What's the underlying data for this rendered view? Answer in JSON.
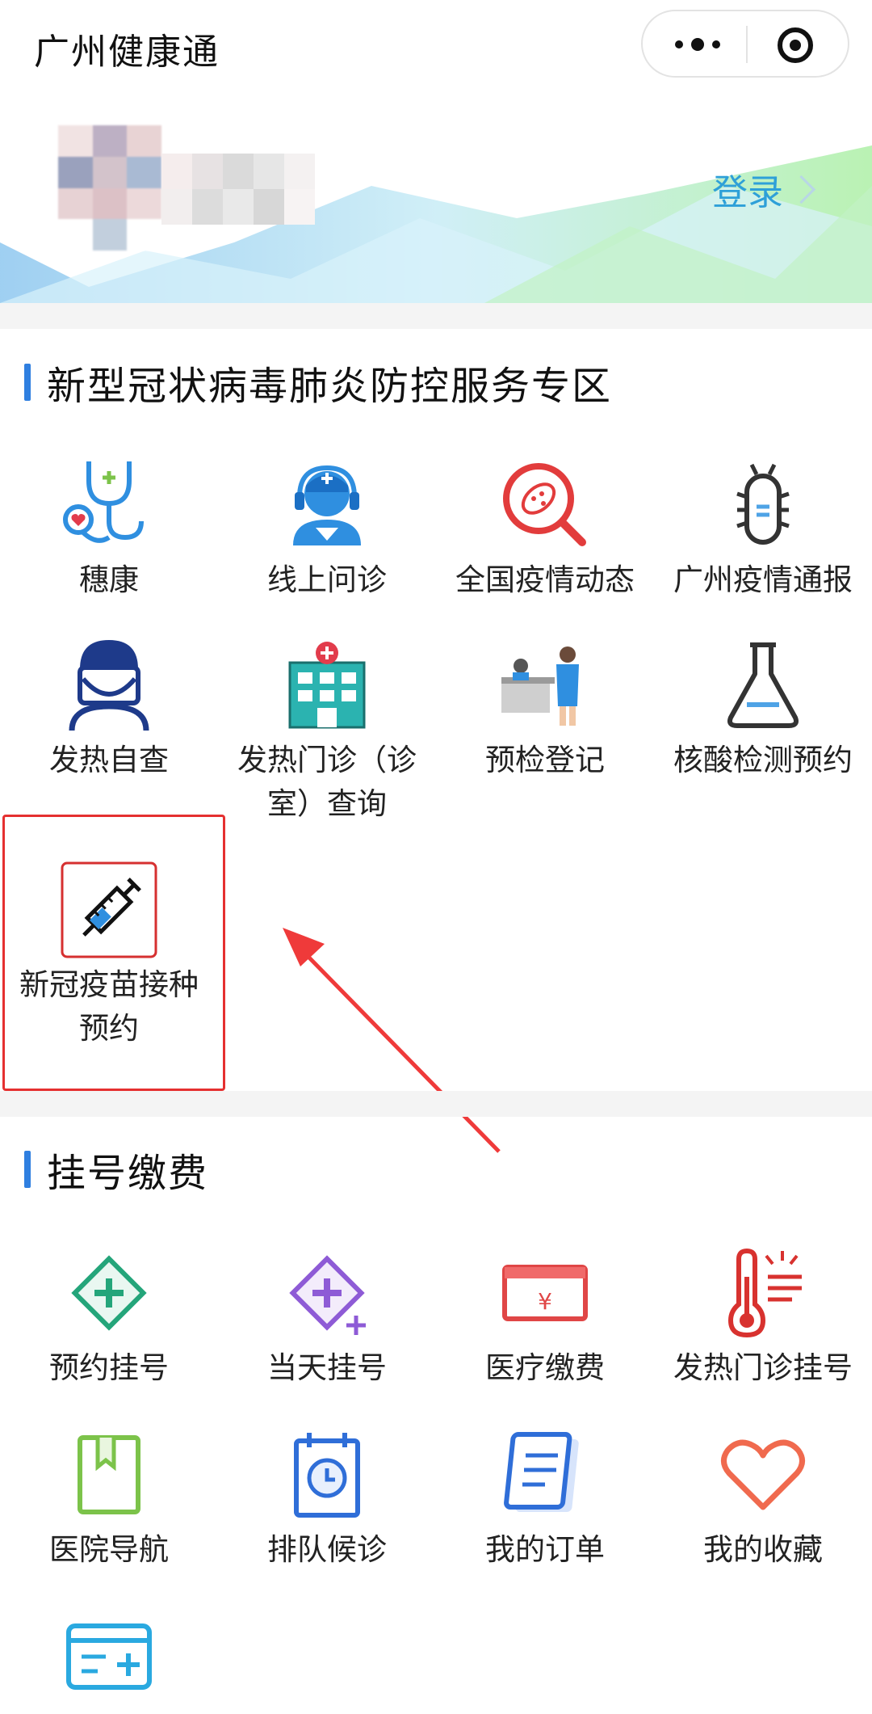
{
  "app": {
    "title": "广州健康通"
  },
  "banner": {
    "login_label": "登录"
  },
  "colors": {
    "accent": "#2f7fe0",
    "login": "#2ea0d8",
    "highlight": "#e53030"
  },
  "section_covid": {
    "title": "新型冠状病毒肺炎防控服务专区",
    "items": [
      {
        "label": "穗康",
        "icon": "stethoscope-icon"
      },
      {
        "label": "线上问诊",
        "icon": "doctor-headset-icon"
      },
      {
        "label": "全国疫情动态",
        "icon": "virus-magnifier-icon"
      },
      {
        "label": "广州疫情通报",
        "icon": "bug-icon"
      },
      {
        "label": "发热自查",
        "icon": "masked-person-icon"
      },
      {
        "label": "发热门诊（诊室）查询",
        "icon": "hospital-icon"
      },
      {
        "label": "预检登记",
        "icon": "reception-desk-icon"
      },
      {
        "label": "核酸检测预约",
        "icon": "flask-icon"
      },
      {
        "label": "新冠疫苗接种预约",
        "icon": "syringe-icon"
      }
    ]
  },
  "section_register": {
    "title": "挂号缴费",
    "items": [
      {
        "label": "预约挂号",
        "icon": "diamond-cross-icon"
      },
      {
        "label": "当天挂号",
        "icon": "diamond-cross-sparkle-icon"
      },
      {
        "label": "医疗缴费",
        "icon": "yuan-card-icon"
      },
      {
        "label": "发热门诊挂号",
        "icon": "thermometer-icon"
      },
      {
        "label": "医院导航",
        "icon": "bookmark-icon"
      },
      {
        "label": "排队候诊",
        "icon": "calendar-clock-icon"
      },
      {
        "label": "我的订单",
        "icon": "document-icon"
      },
      {
        "label": "我的收藏",
        "icon": "heart-icon"
      },
      {
        "label": "",
        "icon": "card-plus-icon"
      }
    ]
  }
}
